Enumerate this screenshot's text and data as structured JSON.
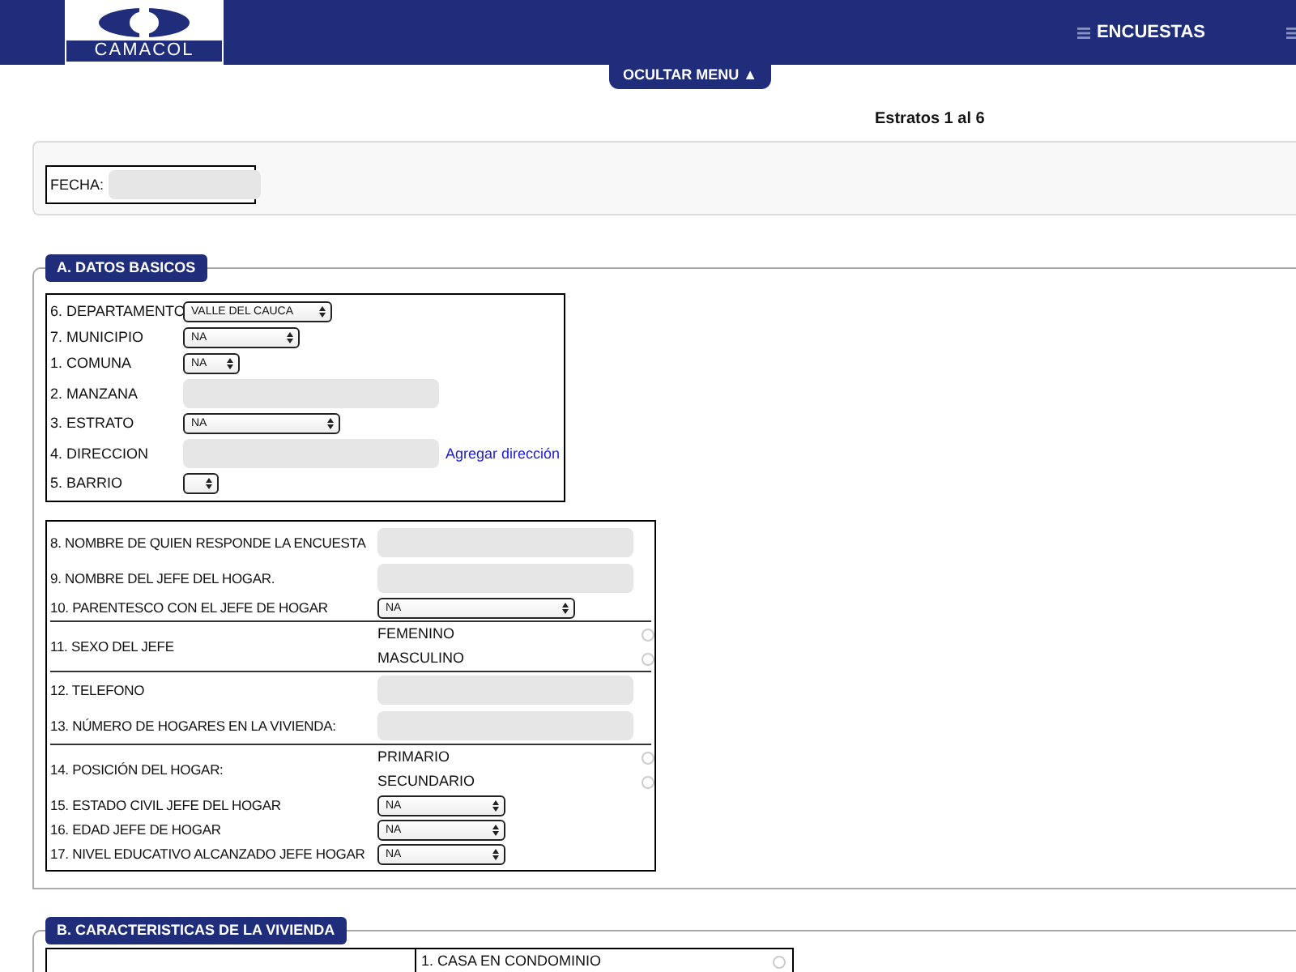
{
  "header": {
    "logo": "CAMACOL",
    "menu": [
      {
        "label": "ENCUESTAS"
      }
    ],
    "toggle": "OCULTAR MENU ▲"
  },
  "subtitle": "Estratos 1 al 6",
  "fecha": {
    "label": "FECHA:"
  },
  "section_a": {
    "title": "A. DATOS BASICOS",
    "group_1": [
      {
        "kind": "select",
        "label": "6. DEPARTAMENTO",
        "value": "VALLE DEL CAUCA"
      },
      {
        "kind": "select",
        "label": "7. MUNICIPIO",
        "value": "NA"
      },
      {
        "kind": "select",
        "label": "1. COMUNA",
        "value": "NA"
      },
      {
        "kind": "input",
        "label": "2. MANZANA"
      },
      {
        "kind": "select",
        "label": "3. ESTRATO",
        "value": "NA"
      },
      {
        "kind": "input",
        "label": "4. DIRECCION",
        "link": "Agregar dirección"
      },
      {
        "kind": "select",
        "label": "5. BARRIO"
      }
    ],
    "group_2": [
      {
        "kind": "input",
        "label": "8. NOMBRE DE QUIEN RESPONDE LA ENCUESTA"
      },
      {
        "kind": "input",
        "label": "9. NOMBRE DEL JEFE DEL HOGAR."
      },
      {
        "kind": "select",
        "label": "10. PARENTESCO CON EL JEFE DE HOGAR",
        "value": "NA"
      },
      {
        "kind": "radio",
        "label": "11. SEXO DEL JEFE",
        "options": [
          {
            "label": "FEMENINO",
            "selected": false
          },
          {
            "label": "MASCULINO",
            "selected": false
          }
        ]
      },
      {
        "kind": "input",
        "label": "12. TELEFONO"
      },
      {
        "kind": "input",
        "label": "13. NÚMERO DE HOGARES EN LA VIVIENDA:"
      },
      {
        "kind": "radio",
        "label": "14. POSICIÓN DEL HOGAR:",
        "options": [
          {
            "label": "PRIMARIO",
            "selected": false
          },
          {
            "label": "SECUNDARIO",
            "selected": false
          }
        ]
      },
      {
        "kind": "select",
        "label": "15. ESTADO CIVIL JEFE DEL HOGAR",
        "value": "NA"
      },
      {
        "kind": "select",
        "label": "16. EDAD JEFE DE HOGAR",
        "value": "NA"
      },
      {
        "kind": "select",
        "label": "17. NIVEL EDUCATIVO ALCANZADO JEFE HOGAR",
        "value": "NA"
      }
    ]
  },
  "section_b": {
    "title": "B. CARACTERISTICAS DE LA VIVIENDA",
    "options": [
      {
        "label": "1. CASA EN CONDOMINIO",
        "selected": false
      }
    ]
  }
}
